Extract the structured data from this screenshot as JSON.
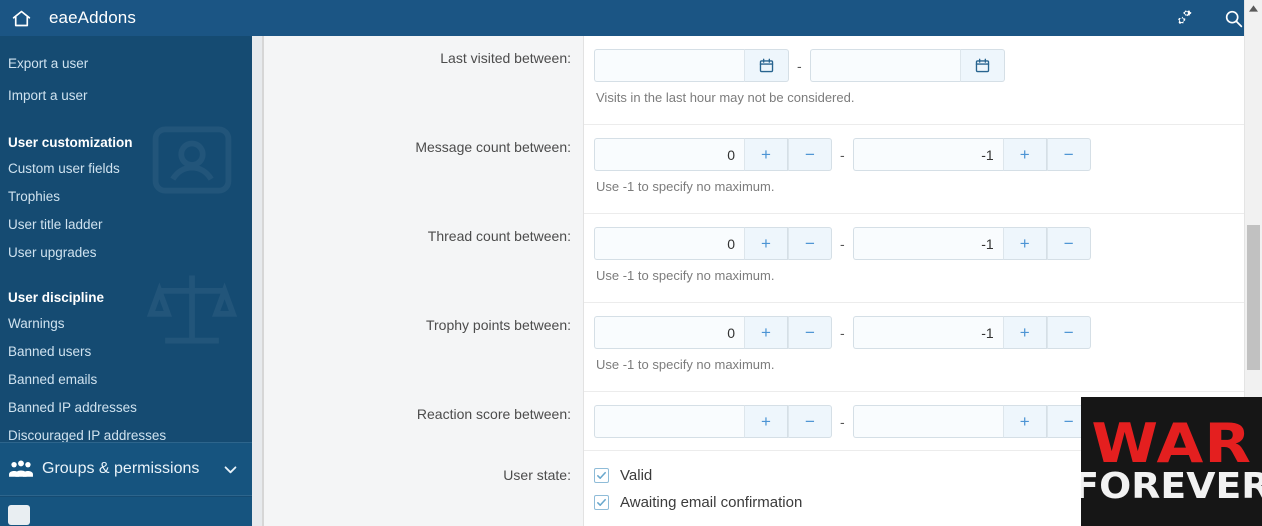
{
  "header": {
    "title": "eaeAddons",
    "home_icon": "home-icon",
    "tools_icon": "gears-icon",
    "search_icon": "search-icon"
  },
  "sidebar": {
    "cut_item_top": "",
    "items_top": [
      {
        "label": "Export a user"
      },
      {
        "label": "Import a user"
      }
    ],
    "sections": [
      {
        "heading": "User customization",
        "items": [
          {
            "label": "Custom user fields"
          },
          {
            "label": "Trophies"
          },
          {
            "label": "User title ladder"
          },
          {
            "label": "User upgrades"
          }
        ]
      },
      {
        "heading": "User discipline",
        "items": [
          {
            "label": "Warnings"
          },
          {
            "label": "Banned users"
          },
          {
            "label": "Banned emails"
          },
          {
            "label": "Banned IP addresses"
          },
          {
            "label": "Discouraged IP addresses"
          }
        ]
      }
    ],
    "groups_entry": {
      "label": "Groups & permissions",
      "icon": "users-icon",
      "chevron": "chevron-down-icon"
    }
  },
  "form": {
    "rows": [
      {
        "label": "Last visited between:",
        "type": "date_range",
        "start_value": "",
        "end_value": "",
        "separator": "-",
        "icon": "calendar-icon",
        "hint": "Visits in the last hour may not be considered."
      },
      {
        "label": "Message count between:",
        "type": "number_range",
        "start_value": "0",
        "end_value": "-1",
        "separator": "-",
        "plus_label": "+",
        "minus_label": "−",
        "hint": "Use -1 to specify no maximum."
      },
      {
        "label": "Thread count between:",
        "type": "number_range",
        "start_value": "0",
        "end_value": "-1",
        "separator": "-",
        "plus_label": "+",
        "minus_label": "−",
        "hint": "Use -1 to specify no maximum."
      },
      {
        "label": "Trophy points between:",
        "type": "number_range",
        "start_value": "0",
        "end_value": "-1",
        "separator": "-",
        "plus_label": "+",
        "minus_label": "−",
        "hint": "Use -1 to specify no maximum."
      },
      {
        "label": "Reaction score between:",
        "type": "number_range",
        "start_value": "",
        "end_value": "",
        "separator": "-",
        "plus_label": "+",
        "minus_label": "−",
        "hint": ""
      }
    ],
    "user_state": {
      "label": "User state:",
      "options": [
        {
          "label": "Valid",
          "checked": true
        },
        {
          "label": "Awaiting email confirmation",
          "checked": true
        }
      ]
    }
  },
  "overlay": {
    "line1": "WAR",
    "line2": "FOREVER"
  },
  "colors": {
    "header_blue": "#1b5584",
    "sidebar_blue": "#154b72",
    "accent_blue": "#4c94d4",
    "overlay_red": "#e41f1f"
  }
}
